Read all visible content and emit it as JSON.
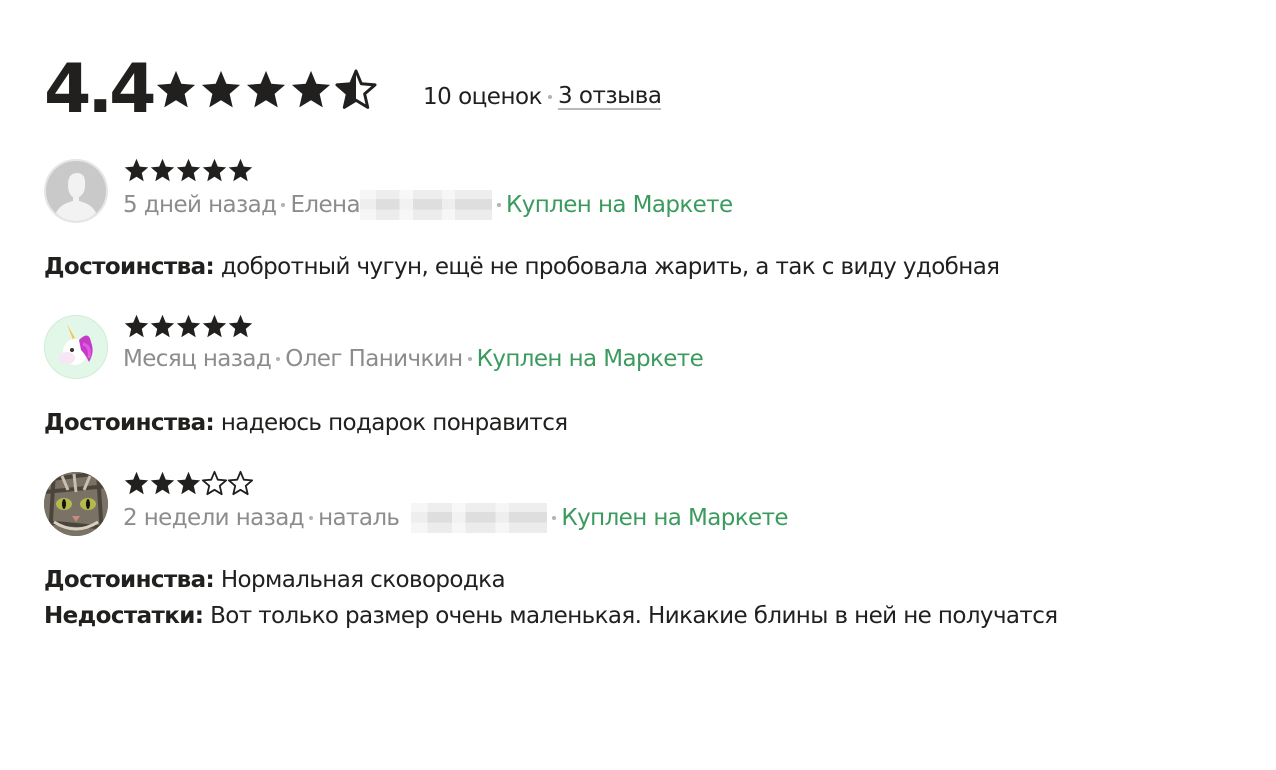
{
  "rating": {
    "value": "4.4",
    "stars": 4.5,
    "ratings_count": "10 оценок",
    "reviews_link": "3 отзыва"
  },
  "colors": {
    "star": "#21201f",
    "bought": "#3b9b5e",
    "meta": "#8c8c8c"
  },
  "reviews": [
    {
      "avatar": "default-user-avatar",
      "stars": 5,
      "date": "5 дней назад",
      "author": "Елена",
      "bought": "Куплен на Маркете",
      "pros_label": "Достоинства:",
      "pros": "добротный чугун, ещё не пробовала жарить, а так с виду удобная"
    },
    {
      "avatar": "unicorn-avatar",
      "stars": 5,
      "date": "Месяц назад",
      "author": "Олег Паничкин",
      "bought": "Куплен на Маркете",
      "pros_label": "Достоинства:",
      "pros": "надеюсь подарок понравится"
    },
    {
      "avatar": "cat-avatar",
      "stars": 3,
      "date": "2 недели назад",
      "author": "наталь",
      "bought": "Куплен на Маркете",
      "pros_label": "Достоинства:",
      "pros": "Нормальная сковородка",
      "cons_label": "Недостатки:",
      "cons": "Вот только размер очень маленькая. Никакие блины в ней не получатся"
    }
  ]
}
